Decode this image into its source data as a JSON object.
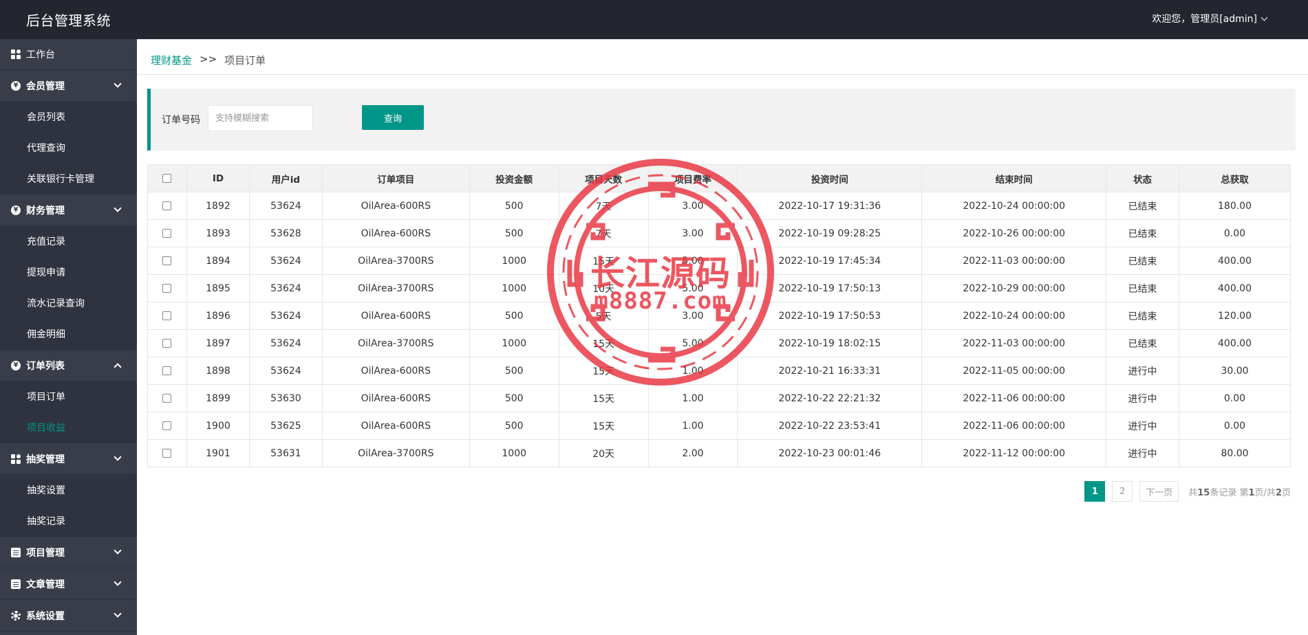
{
  "header": {
    "app_title": "后台管理系统",
    "user_greeting": "欢迎您，管理员[admin]"
  },
  "sidebar": {
    "dashboard_label": "工作台",
    "groups": [
      {
        "label": "会员管理",
        "icon": "circle-icon",
        "expanded": false,
        "items": [
          "会员列表",
          "代理查询",
          "关联银行卡管理"
        ]
      },
      {
        "label": "财务管理",
        "icon": "circle-icon",
        "expanded": false,
        "items": [
          "充值记录",
          "提现申请",
          "流水记录查询",
          "佣金明细"
        ]
      },
      {
        "label": "订单列表",
        "icon": "circle-icon",
        "expanded": true,
        "items": [
          "项目订单",
          "项目收益"
        ]
      },
      {
        "label": "抽奖管理",
        "icon": "grid-icon",
        "expanded": false,
        "items": [
          "抽奖设置",
          "抽奖记录"
        ]
      },
      {
        "label": "项目管理",
        "icon": "doc-icon",
        "expanded": false,
        "items": []
      },
      {
        "label": "文章管理",
        "icon": "doc-icon",
        "expanded": false,
        "items": []
      },
      {
        "label": "系统设置",
        "icon": "gear-icon",
        "expanded": false,
        "items": []
      }
    ],
    "active_item": "项目收益"
  },
  "breadcrumb": {
    "parent": "理财基金",
    "separator": ">>",
    "current": "项目订单"
  },
  "search": {
    "label": "订单号码",
    "placeholder": "支持模糊搜索",
    "value": "",
    "button_label": "查询"
  },
  "table": {
    "columns": [
      "ID",
      "用户id",
      "订单项目",
      "投资金额",
      "项目天数",
      "项目费率",
      "投资时间",
      "结束时间",
      "状态",
      "总获取"
    ],
    "rows": [
      [
        "1892",
        "53624",
        "OilArea-600RS",
        "500",
        "7天",
        "3.00",
        "2022-10-17 19:31:36",
        "2022-10-24 00:00:00",
        "已结束",
        "180.00"
      ],
      [
        "1893",
        "53628",
        "OilArea-600RS",
        "500",
        "7天",
        "3.00",
        "2022-10-19 09:28:25",
        "2022-10-26 00:00:00",
        "已结束",
        "0.00"
      ],
      [
        "1894",
        "53624",
        "OilArea-3700RS",
        "1000",
        "15天",
        "5.00",
        "2022-10-19 17:45:34",
        "2022-11-03 00:00:00",
        "已结束",
        "400.00"
      ],
      [
        "1895",
        "53624",
        "OilArea-3700RS",
        "1000",
        "10天",
        "5.00",
        "2022-10-19 17:50:13",
        "2022-10-29 00:00:00",
        "已结束",
        "400.00"
      ],
      [
        "1896",
        "53624",
        "OilArea-600RS",
        "500",
        "5天",
        "3.00",
        "2022-10-19 17:50:53",
        "2022-10-24 00:00:00",
        "已结束",
        "120.00"
      ],
      [
        "1897",
        "53624",
        "OilArea-3700RS",
        "1000",
        "15天",
        "5.00",
        "2022-10-19 18:02:15",
        "2022-11-03 00:00:00",
        "已结束",
        "400.00"
      ],
      [
        "1898",
        "53624",
        "OilArea-600RS",
        "500",
        "15天",
        "1.00",
        "2022-10-21 16:33:31",
        "2022-11-05 00:00:00",
        "进行中",
        "30.00"
      ],
      [
        "1899",
        "53630",
        "OilArea-600RS",
        "500",
        "15天",
        "1.00",
        "2022-10-22 22:21:32",
        "2022-11-06 00:00:00",
        "进行中",
        "0.00"
      ],
      [
        "1900",
        "53625",
        "OilArea-600RS",
        "500",
        "15天",
        "1.00",
        "2022-10-22 23:53:41",
        "2022-11-06 00:00:00",
        "进行中",
        "0.00"
      ],
      [
        "1901",
        "53631",
        "OilArea-3700RS",
        "1000",
        "20天",
        "2.00",
        "2022-10-23 00:01:46",
        "2022-11-12 00:00:00",
        "进行中",
        "80.00"
      ]
    ]
  },
  "pagination": {
    "pages": [
      "1",
      "2"
    ],
    "current_page": "1",
    "next_label": "下一页",
    "info_prefix": "共",
    "total_records": "15",
    "info_records_suffix": "条记录 第",
    "info_current": "1",
    "info_page_mid": "页/共",
    "info_total_pages": "2",
    "info_suffix": "页"
  },
  "watermark": {
    "title": "长江源码",
    "subtitle": "m8887.com",
    "color": "#e8333f"
  },
  "colors": {
    "accent": "#009688",
    "header_bg": "#23262e",
    "sidebar_bg": "#393d49",
    "submenu_bg": "#2f333f"
  }
}
